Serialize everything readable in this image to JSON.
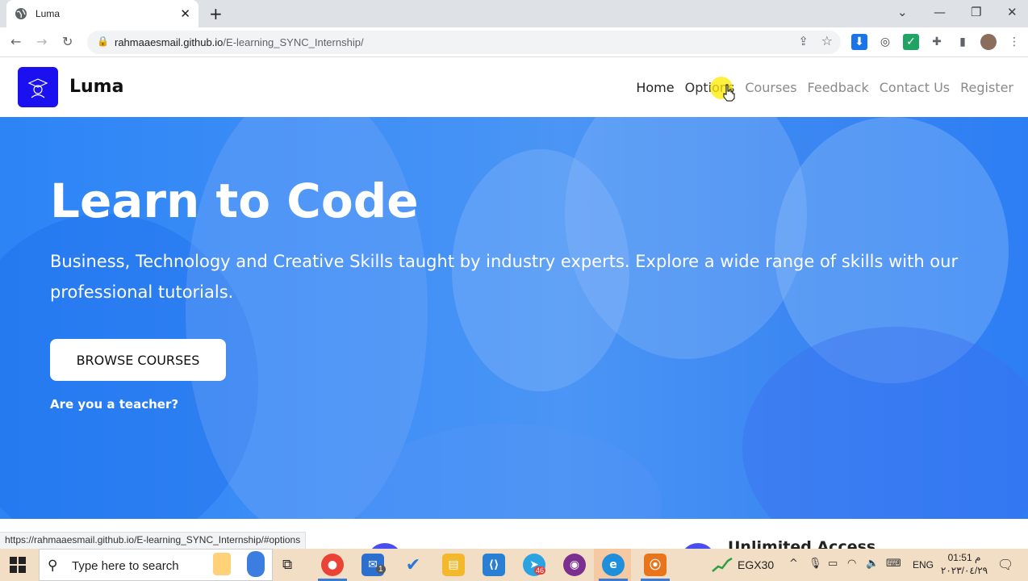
{
  "browser": {
    "tab_title": "Luma",
    "url_host": "rahmaaesmail.github.io",
    "url_path": "/E-learning_SYNC_Internship/",
    "status_url": "https://rahmaaesmail.github.io/E-learning_SYNC_Internship/#options"
  },
  "site": {
    "brand": "Luma",
    "nav": [
      "Home",
      "Options",
      "Courses",
      "Feedback",
      "Contact Us",
      "Register"
    ]
  },
  "hero": {
    "title": "Learn to Code",
    "subtitle": "Business, Technology and Creative Skills taught by industry experts. Explore a wide range of skills with our professional tutorials.",
    "button": "BROWSE COURSES",
    "teacher_link": "Are you a teacher?"
  },
  "below": {
    "feature_title": "Unlimited Access"
  },
  "taskbar": {
    "search_placeholder": "Type here to search",
    "stock_label": "EGX30",
    "language": "ENG",
    "time": "01:51 م",
    "date": "٢٠٢٣/٠٤/٢٩",
    "mail_badge": "1",
    "telegram_badge": "46"
  },
  "colors": {
    "hero_blue": "#3a8cf5",
    "logo_blue": "#1a10f0",
    "taskbar": "#f2ddc5"
  }
}
